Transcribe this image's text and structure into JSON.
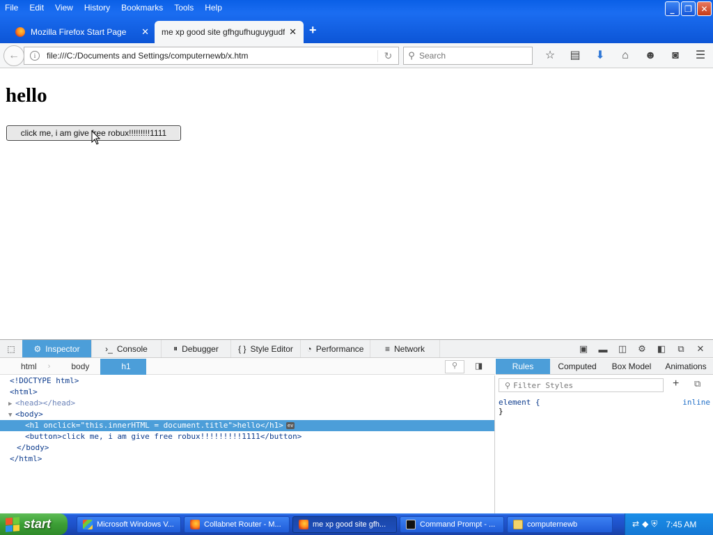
{
  "menubar": {
    "items": [
      "File",
      "Edit",
      "View",
      "History",
      "Bookmarks",
      "Tools",
      "Help"
    ]
  },
  "window_buttons": {
    "minimize": "_",
    "restore": "❐",
    "close": "✕"
  },
  "tabs": [
    {
      "label": "Mozilla Firefox Start Page",
      "close": "✕"
    },
    {
      "label": "me xp good site gfhgufhuguygudf",
      "close": "✕"
    }
  ],
  "new_tab": "+",
  "navbar": {
    "url": "file:///C:/Documents and Settings/computernewb/x.htm",
    "search_placeholder": "Search"
  },
  "page": {
    "heading": "hello",
    "button_label": "click me, i am give free robux!!!!!!!!!1111"
  },
  "devtools": {
    "tabs": [
      "Inspector",
      "Console",
      "Debugger",
      "Style Editor",
      "Performance",
      "Network"
    ],
    "breadcrumbs": [
      "html",
      "body",
      "h1"
    ],
    "markup": [
      "<!DOCTYPE html>",
      "<html>",
      "<head></head>",
      "<body>",
      "<h1 onclick=\"this.innerHTML = document.title\">hello</h1>",
      "<button>click me, i am give free robux!!!!!!!!!1111</button>",
      "</body>",
      "</html>"
    ],
    "event_badge": "ev",
    "rules_tabs": [
      "Rules",
      "Computed",
      "Box Model",
      "Animations"
    ],
    "filter_placeholder": "Filter Styles",
    "rule_selector": "element {",
    "rule_close": "}",
    "rule_source": "inline"
  },
  "taskbar": {
    "start_label": "start",
    "tasks": [
      "Microsoft Windows V...",
      "Collabnet Router - M...",
      "me xp good site gfh...",
      "Command Prompt - ...",
      "computernewb"
    ],
    "clock": "7:45 AM"
  },
  "colors": {
    "xp_blue": "#0c55d6",
    "devtools_accent": "#4c9ed9",
    "start_green": "#3c9e35"
  }
}
